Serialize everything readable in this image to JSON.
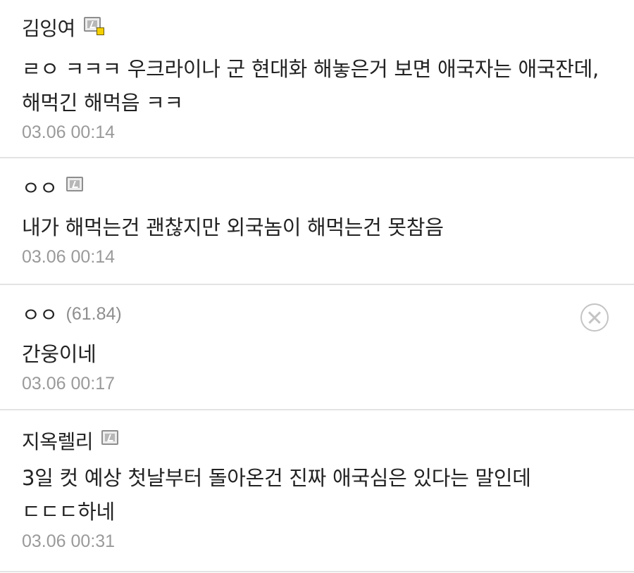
{
  "comments": [
    {
      "author": "김잉여",
      "member_icon": "member-icon",
      "text": "ㄹㅇ ㅋㅋㅋ 우크라이나 군 현대화 해놓은거 보면 애국자는 애국잔데, 해먹긴 해먹음 ㅋㅋ",
      "date": "03.06 00:14"
    },
    {
      "author": "ㅇㅇ",
      "member_icon": "member-icon",
      "text": "내가 해먹는건 괜찮지만 외국놈이 해먹는건 못참음",
      "date": "03.06 00:14"
    },
    {
      "author": "ㅇㅇ",
      "ip": "(61.84)",
      "text": "간웅이네",
      "date": "03.06 00:17",
      "delete_icon": "close-circle-icon"
    },
    {
      "author": "지옥렐리",
      "member_icon": "member-icon",
      "text": "3일 컷 예상 첫날부터 돌아온건 진짜 애국심은 있다는 말인데 ㄷㄷㄷ하네",
      "date": "03.06 00:31"
    }
  ]
}
